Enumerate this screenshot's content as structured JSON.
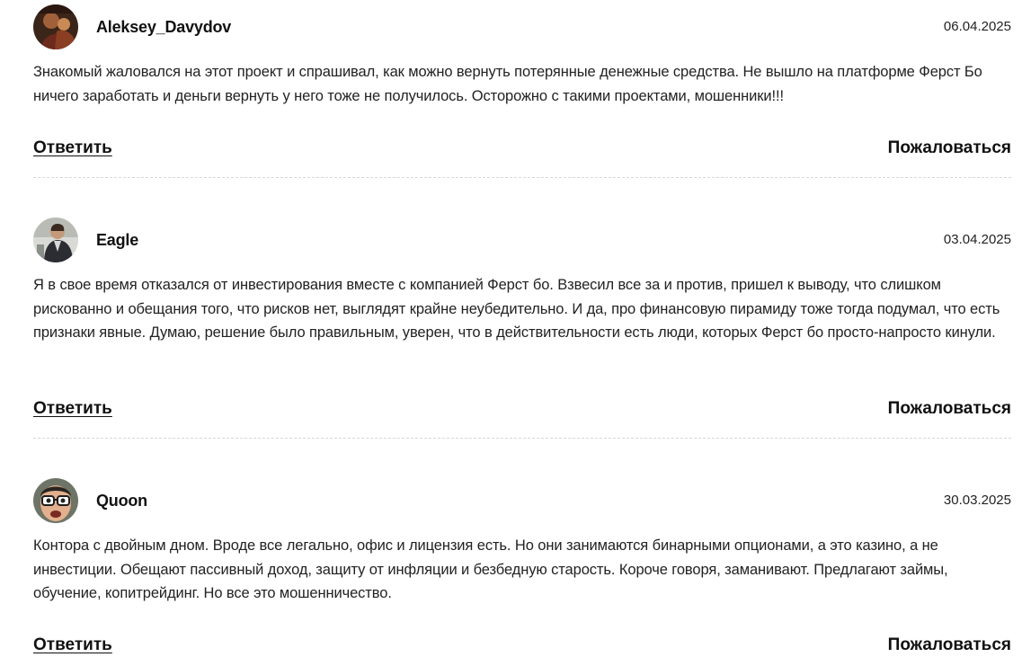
{
  "comments": [
    {
      "author": "Aleksey_Davydov",
      "date": "06.04.2025",
      "text": "Знакомый жаловался на этот проект и спрашивал, как можно вернуть потерянные денежные средства. Не вышло на платформе Ферст Бо ничего заработать и деньги вернуть у него тоже не получилось. Осторожно с такими проектами, мошенники!!!",
      "reply_label": "Ответить",
      "report_label": "Пожаловаться"
    },
    {
      "author": "Eagle",
      "date": "03.04.2025",
      "text": "Я в свое время отказался от инвестирования вместе с компанией Ферст бо. Взвесил все за и против, пришел к выводу, что слишком рискованно и обещания того, что рисков нет, выглядят крайне неубедительно. И да, про финансовую пирамиду тоже тогда подумал, что есть признаки явные. Думаю, решение было правильным, уверен, что в действительности есть люди, которых Ферст бо просто-напросто кинули.",
      "reply_label": "Ответить",
      "report_label": "Пожаловаться"
    },
    {
      "author": "Quoon",
      "date": "30.03.2025",
      "text": "Контора с двойным дном. Вроде все легально, офис и лицензия есть. Но они занимаются бинарными опционами, а это казино, а не инвестиции. Обещают пассивный доход, защиту от инфляции и безбедную старость. Короче говоря, заманивают. Предлагают займы, обучение, копитрейдинг. Но все это мошенничество.",
      "reply_label": "Ответить",
      "report_label": "Пожаловаться"
    }
  ]
}
